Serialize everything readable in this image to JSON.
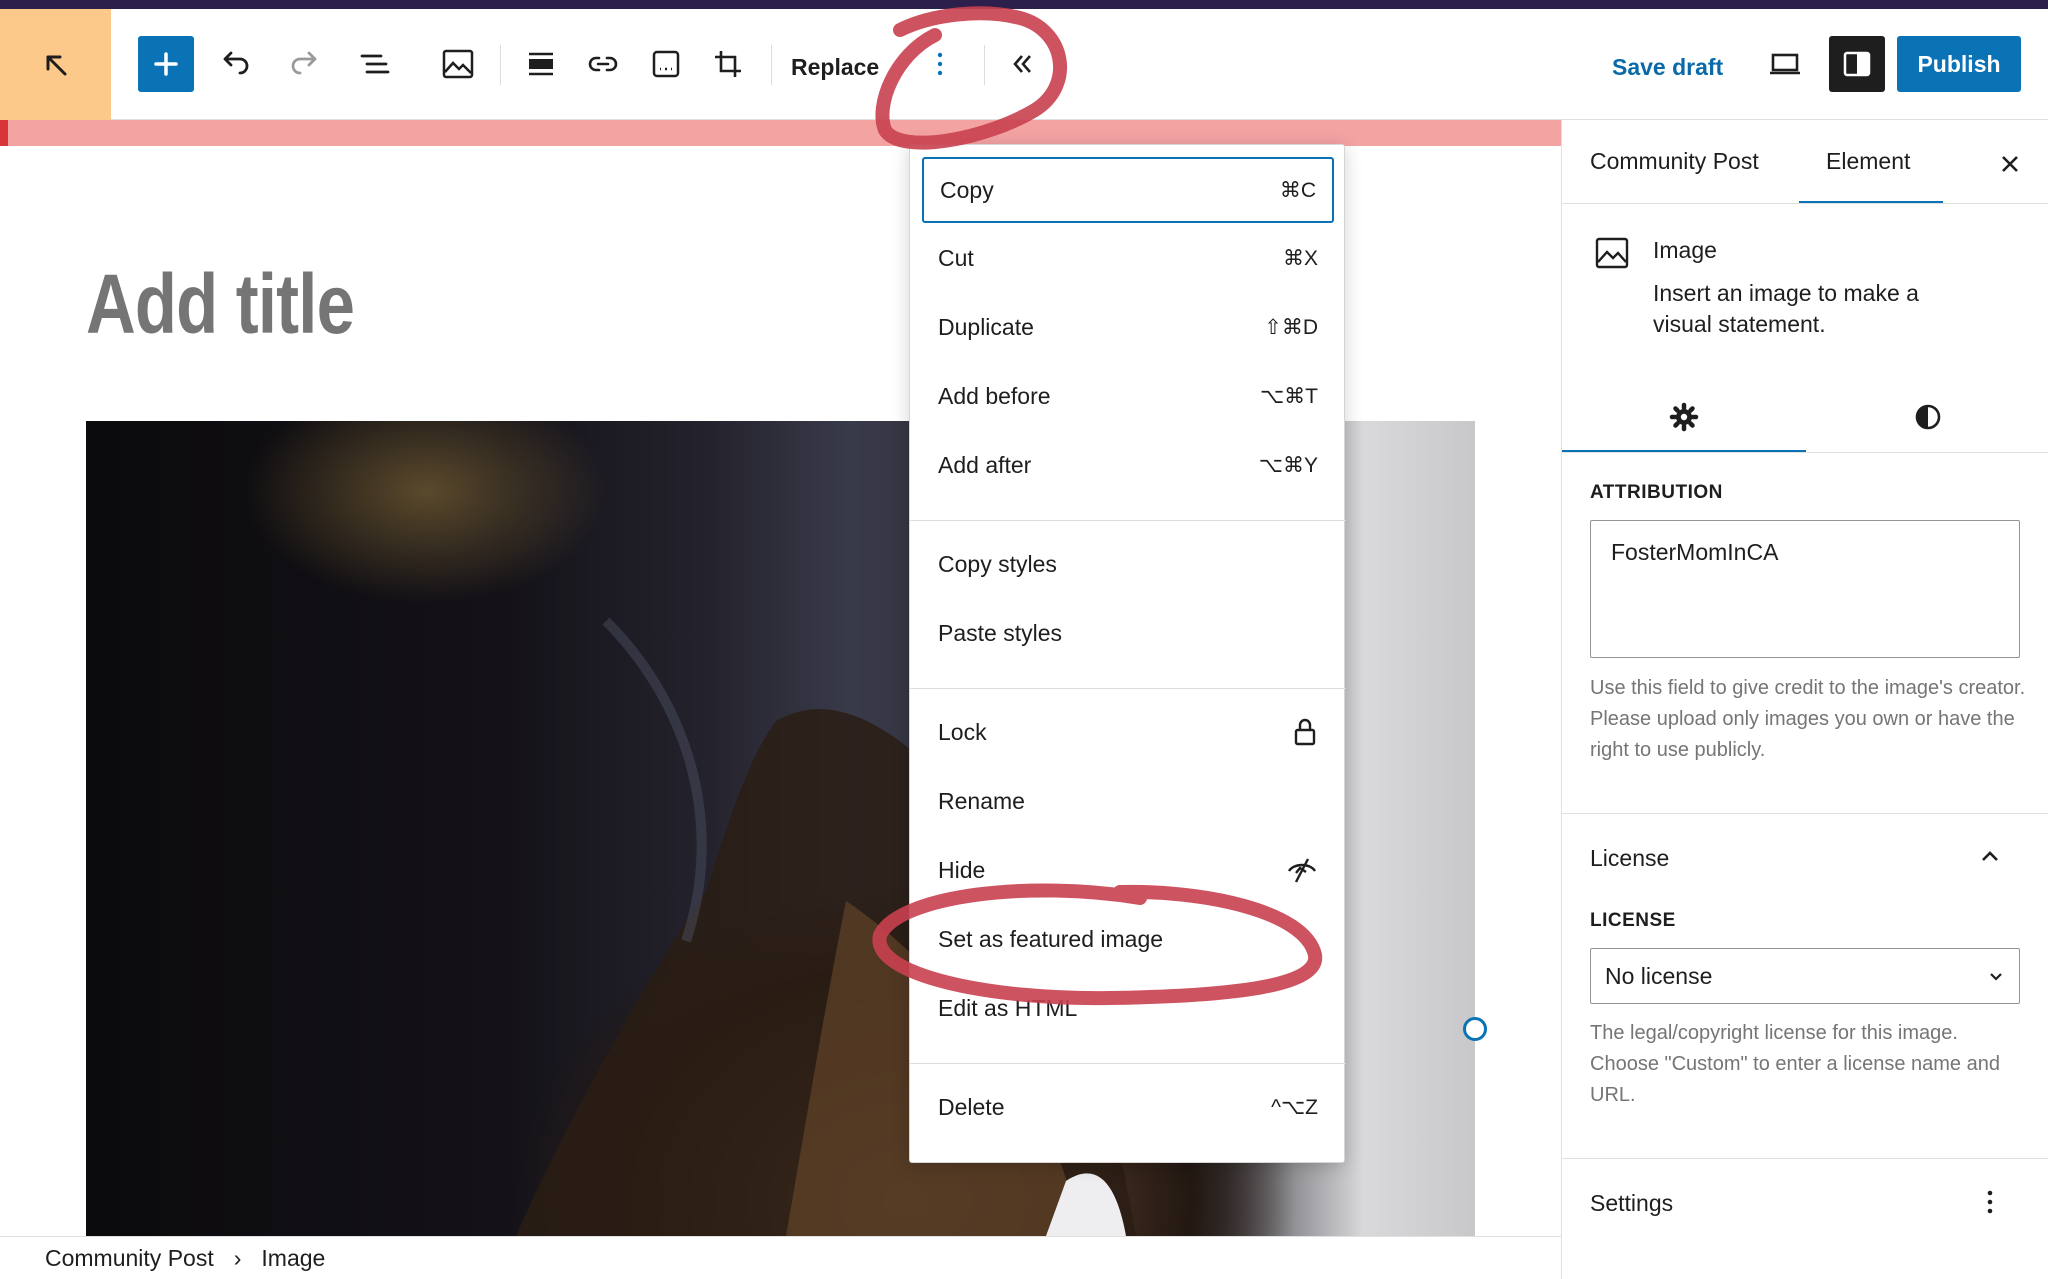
{
  "toolbar": {
    "replace_label": "Replace",
    "save_draft_label": "Save draft",
    "publish_label": "Publish"
  },
  "editor": {
    "title_placeholder": "Add title"
  },
  "block_menu": {
    "group1": [
      {
        "label": "Copy",
        "shortcut": "⌘C"
      },
      {
        "label": "Cut",
        "shortcut": "⌘X"
      },
      {
        "label": "Duplicate",
        "shortcut": "⇧⌘D"
      },
      {
        "label": "Add before",
        "shortcut": "⌥⌘T"
      },
      {
        "label": "Add after",
        "shortcut": "⌥⌘Y"
      }
    ],
    "group2": [
      {
        "label": "Copy styles"
      },
      {
        "label": "Paste styles"
      }
    ],
    "group3": [
      {
        "label": "Lock",
        "icon": "lock-icon"
      },
      {
        "label": "Rename"
      },
      {
        "label": "Hide",
        "icon": "hidden-eye-icon"
      },
      {
        "label": "Set as featured image"
      },
      {
        "label": "Edit as HTML"
      }
    ],
    "group4": [
      {
        "label": "Delete",
        "shortcut": "^⌥Z"
      }
    ]
  },
  "sidebar": {
    "tabs": [
      "Community Post",
      "Element"
    ],
    "active_tab": "Element",
    "block": {
      "name": "Image",
      "description": "Insert an image to make a visual statement."
    },
    "attribution": {
      "label": "ATTRIBUTION",
      "value": "FosterMomInCA",
      "help": "Use this field to give credit to the image's creator. Please upload only images you own or have the right to use publicly."
    },
    "license_section": {
      "title": "License",
      "label": "LICENSE",
      "selected": "No license",
      "help": "The legal/copyright license for this image. Choose \"Custom\" to enter a license name and URL."
    },
    "settings_section": {
      "title": "Settings"
    }
  },
  "breadcrumb": [
    "Community Post",
    "Image"
  ],
  "colors": {
    "accent": "#0a73b5",
    "home_bg": "#fdc98a",
    "notice": "#f4a3a3",
    "annotation": "#c9404f"
  }
}
